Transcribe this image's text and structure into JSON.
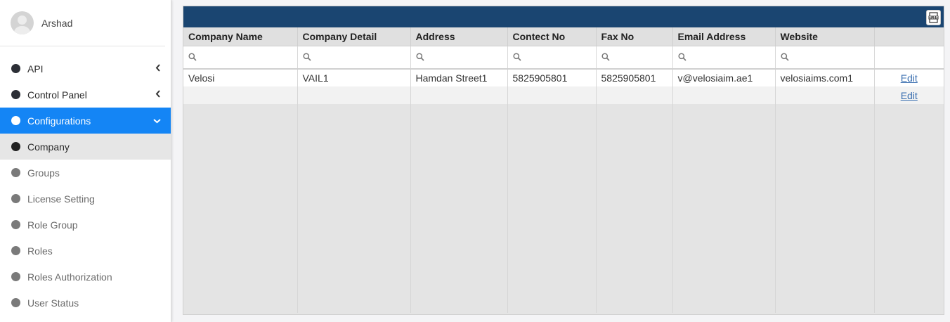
{
  "user": {
    "name": "Arshad"
  },
  "sidebar": {
    "items": [
      {
        "label": "API",
        "icon": "chevron-left-icon"
      },
      {
        "label": "Control Panel",
        "icon": "chevron-left-icon"
      },
      {
        "label": "Configurations",
        "icon": "chevron-down-icon"
      },
      {
        "label": "Company"
      },
      {
        "label": "Groups"
      },
      {
        "label": "License Setting"
      },
      {
        "label": "Role Group"
      },
      {
        "label": "Roles"
      },
      {
        "label": "Roles Authorization"
      },
      {
        "label": "User Status"
      }
    ]
  },
  "toolbar": {
    "export_icon": "xlsx-export-icon"
  },
  "grid": {
    "columns": [
      "Company Name",
      "Company Detail",
      "Address",
      "Contect No",
      "Fax No",
      "Email Address",
      "Website",
      ""
    ],
    "rows": [
      [
        "Velosi",
        "VAIL1",
        "Hamdan Street1",
        "5825905801",
        "5825905801",
        "v@velosiaim.ae1",
        "velosiaims.com1",
        "Edit"
      ],
      [
        "",
        "",
        "",
        "",
        "",
        "",
        "",
        "Edit"
      ]
    ]
  },
  "colors": {
    "header_bar": "#1a4571",
    "active_menu": "#1485f5",
    "link": "#3a6fb0"
  }
}
